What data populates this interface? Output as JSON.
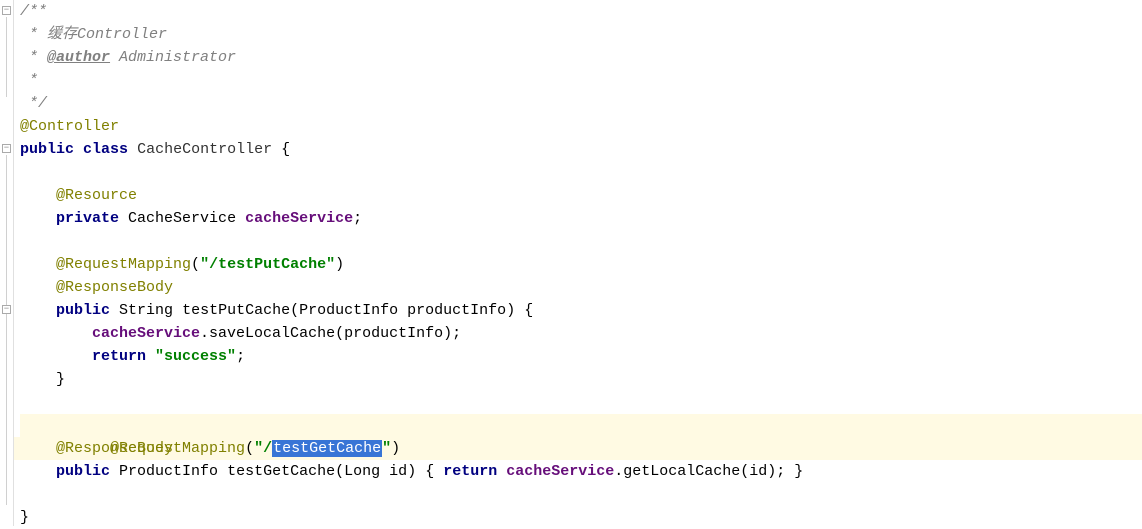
{
  "code": {
    "l1": "/**",
    "l2_prefix": " * ",
    "l2_text": "缓存Controller",
    "l3_prefix": " * ",
    "l3_tag": "@author",
    "l3_after": " Administrator",
    "l4": " *",
    "l5": " */",
    "l6_anno": "@Controller",
    "l7_kw1": "public",
    "l7_kw2": "class",
    "l7_cls": "CacheController",
    "l7_brace": " {",
    "l9_anno": "@Resource",
    "l10_kw": "private",
    "l10_type": "CacheService",
    "l10_field": "cacheService",
    "l10_end": ";",
    "l12_anno": "@RequestMapping",
    "l12_str": "\"/testPutCache\"",
    "l13_anno": "@ResponseBody",
    "l14_kw": "public",
    "l14_ret": "String",
    "l14_name": "testPutCache",
    "l14_ptype": "ProductInfo",
    "l14_pname": "productInfo",
    "l14_end": ") {",
    "l15_field": "cacheService",
    "l15_method": ".saveLocalCache(productInfo);",
    "l16_kw": "return",
    "l16_str": "\"success\"",
    "l16_end": ";",
    "l17": "    }",
    "l19_anno": "@RequestMapping",
    "l19_str_q1": "\"/",
    "l19_sel": "testGetCache",
    "l19_str_q2": "\"",
    "l20_anno": "@ResponseBody",
    "l21_kw": "public",
    "l21_ret": "ProductInfo",
    "l21_name": "testGetCache",
    "l21_ptype": "Long",
    "l21_pname": "id",
    "l21_mid": ") {",
    "l21_kw2": "return",
    "l21_field": "cacheService",
    "l21_rest": ".getLocalCache(id); }",
    "l23": "}"
  }
}
